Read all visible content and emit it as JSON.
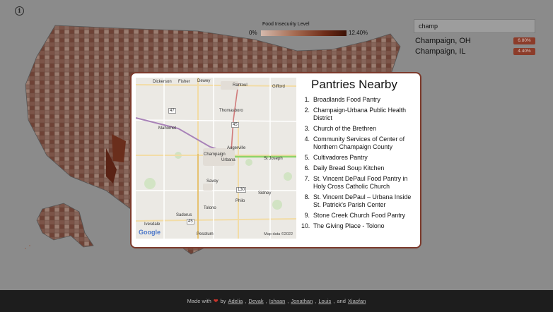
{
  "colors": {
    "overlay": "#8b8b8b",
    "county_light": "#9a7f74",
    "county_dark": "#5a2214",
    "modal_border": "#7c3a2c",
    "badge": "#8c3c2a",
    "footer_bg": "#1d1d1d"
  },
  "info_button": {
    "icon": "info-icon",
    "glyph": "i"
  },
  "legend": {
    "title": "Food Insecurity Level",
    "min": "0%",
    "max": "12.40%"
  },
  "search": {
    "value": "champ",
    "placeholder": ""
  },
  "results": [
    {
      "name": "Champaign, OH",
      "value": "6.80%"
    },
    {
      "name": "Champaign, IL",
      "value": "4.40%"
    }
  ],
  "modal": {
    "title": "Pantries Nearby",
    "map": {
      "attribution": "Map data ©2022",
      "logo_text": "Google",
      "places": [
        "Dickerson",
        "Fisher",
        "Dewey",
        "Rantoul",
        "Gifford",
        "Thomasboro",
        "Mahomet",
        "Champaign",
        "Urbana",
        "Augerville",
        "St Joseph",
        "Savoy",
        "Sidney",
        "Philo",
        "Tolono",
        "Sadorus",
        "Ivesdale",
        "Pesotum"
      ],
      "route_shields": [
        "47",
        "45",
        "130",
        "45"
      ]
    },
    "pantries": [
      {
        "num": "1.",
        "name": "Broadlands Food Pantry"
      },
      {
        "num": "2.",
        "name": "Champaign-Urbana Public Health District"
      },
      {
        "num": "3.",
        "name": "Church of the Brethren"
      },
      {
        "num": "4.",
        "name": "Community Services of Center of Northern Champaign County"
      },
      {
        "num": "5.",
        "name": "Cultivadores Pantry"
      },
      {
        "num": "6.",
        "name": "Daily Bread Soup Kitchen"
      },
      {
        "num": "7.",
        "name": "St. Vincent DePaul Food Pantry in Holy Cross Catholic Church"
      },
      {
        "num": "8.",
        "name": "St. Vincent DePaul – Urbana Inside St. Patrick's Parish Center"
      },
      {
        "num": "9.",
        "name": "Stone Creek Church Food Pantry"
      },
      {
        "num": "10.",
        "name": "The Giving Place - Tolono"
      }
    ]
  },
  "footer": {
    "made_with": "Made with",
    "heart": "❤",
    "by": "by",
    "authors": [
      "Adelia",
      "Devak",
      "Ishaan",
      "Jonathan",
      "Louis"
    ],
    "and": "and",
    "last_author": "Xiaofan"
  }
}
